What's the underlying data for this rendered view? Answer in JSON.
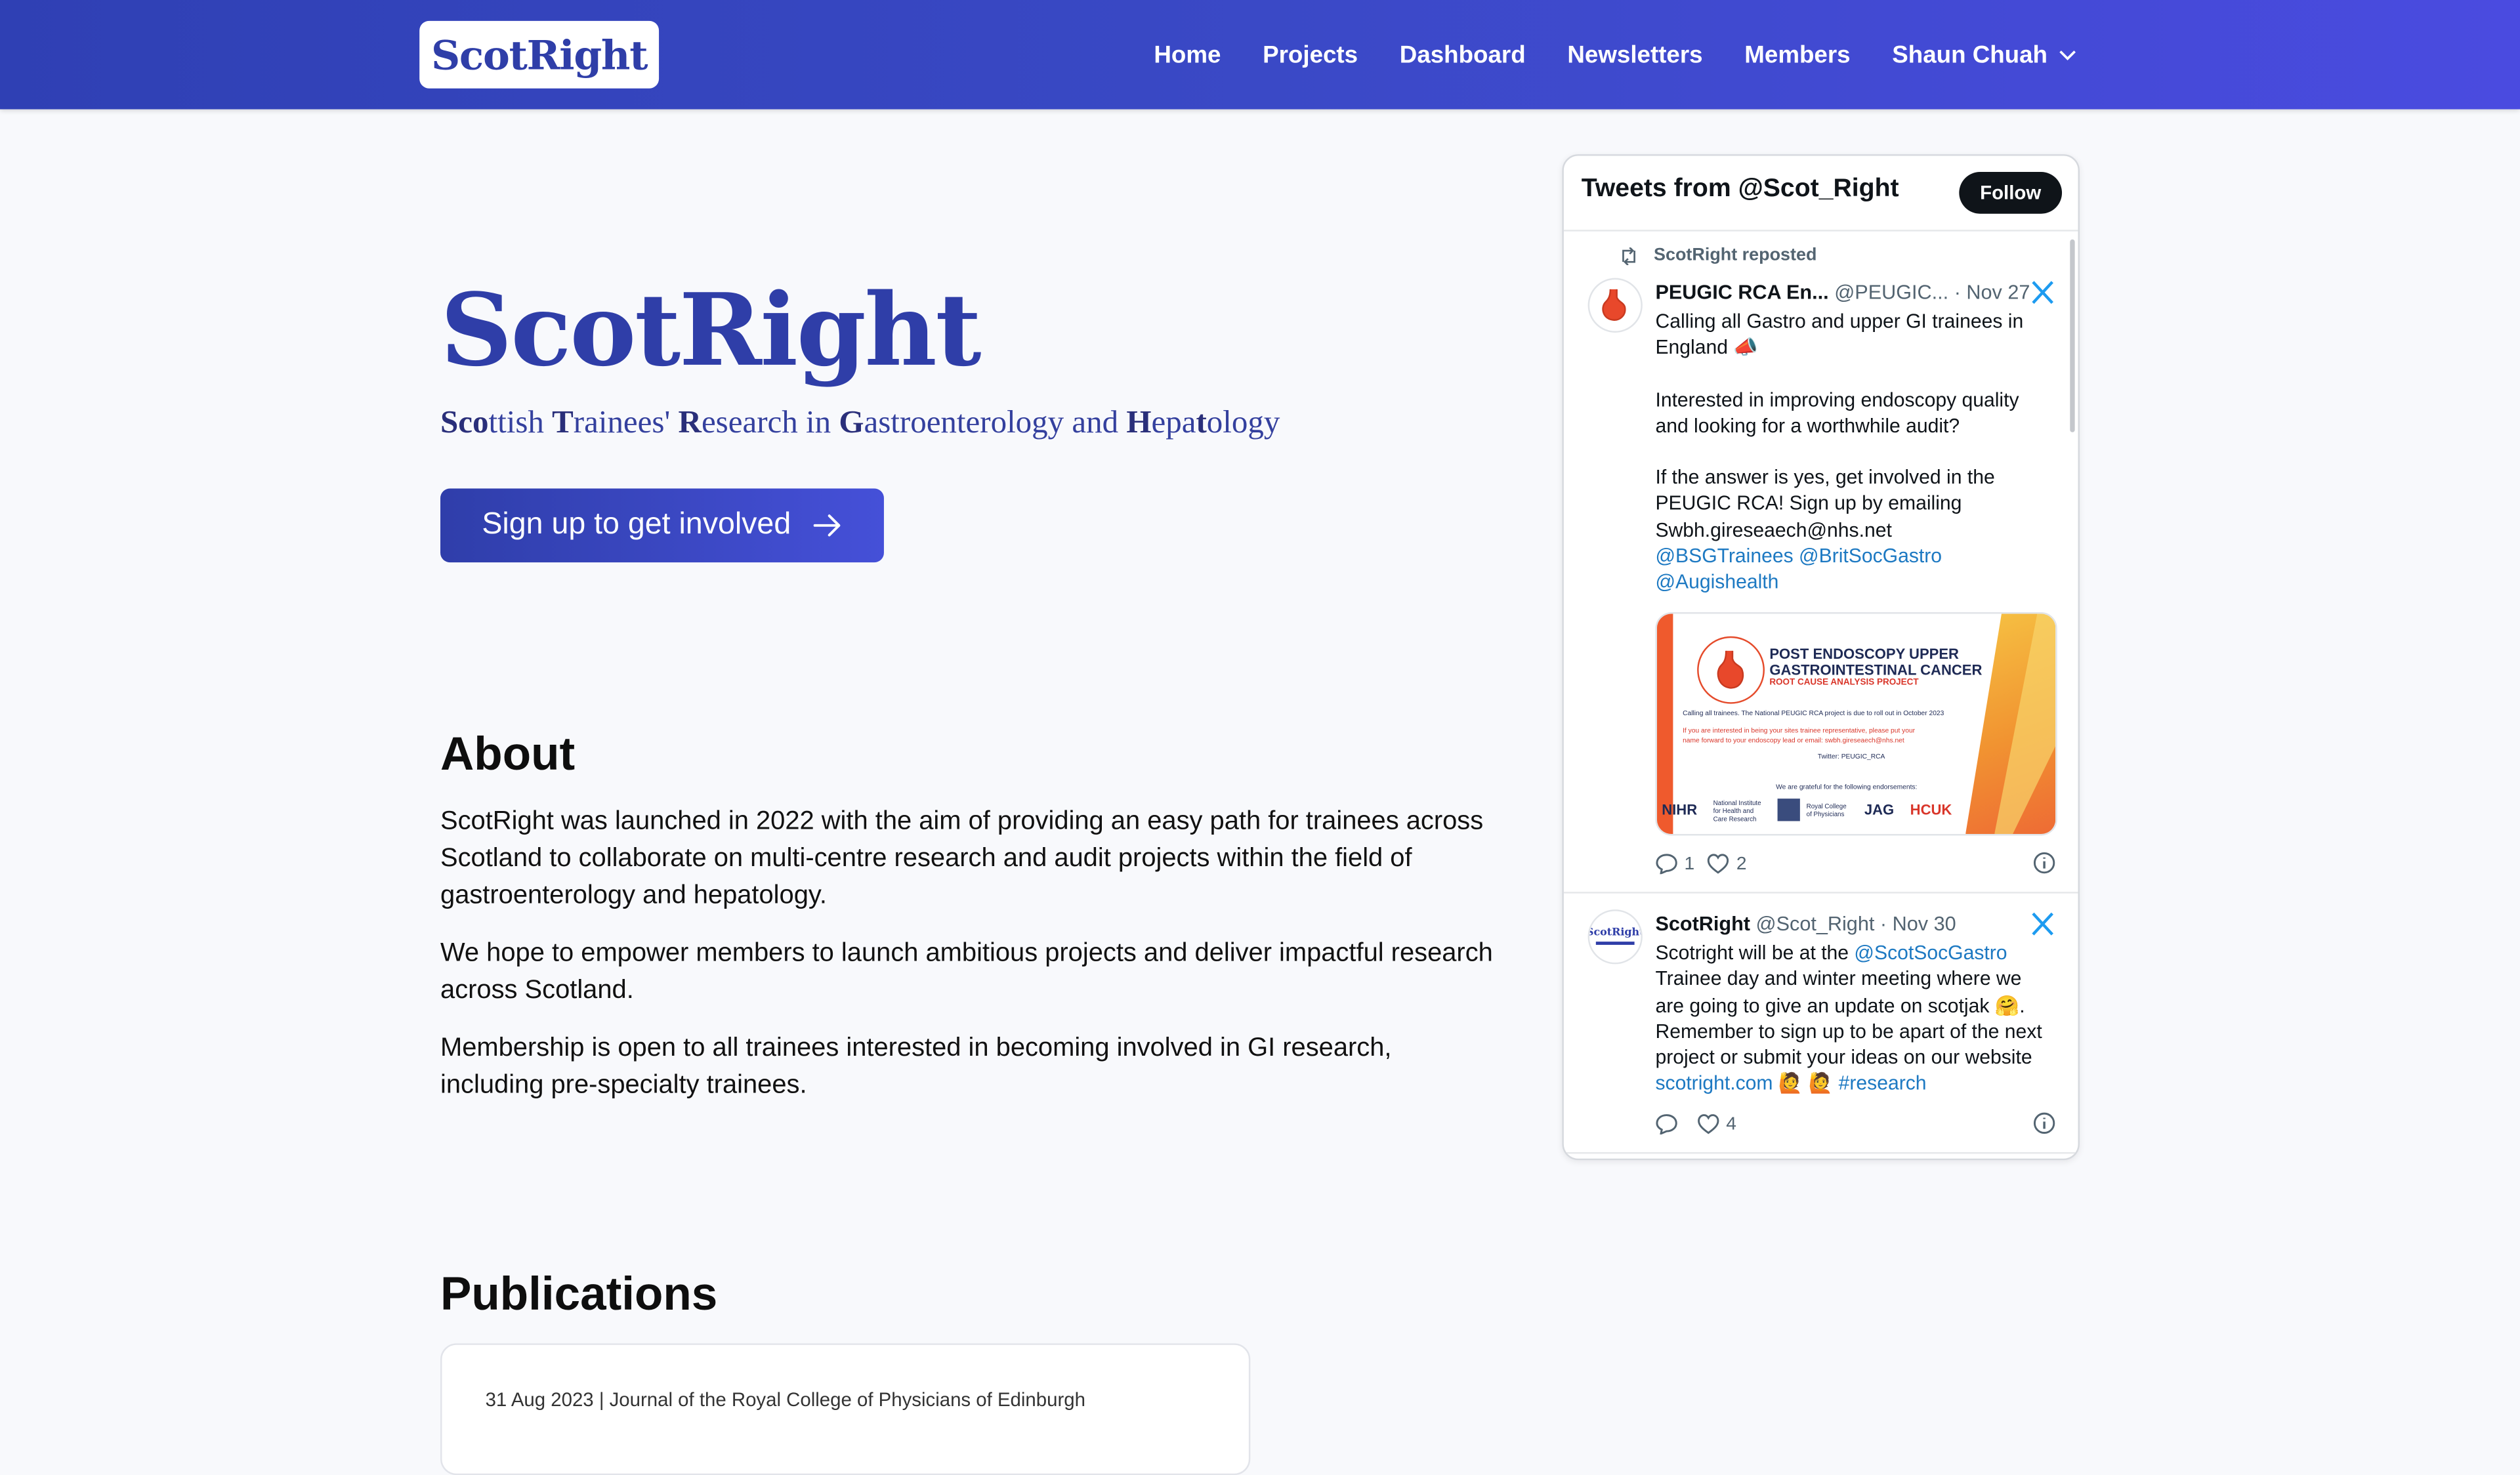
{
  "nav": {
    "logo": "ScotRight",
    "links": [
      "Home",
      "Projects",
      "Dashboard",
      "Newsletters",
      "Members"
    ],
    "user": "Shaun Chuah"
  },
  "hero": {
    "title": "ScotRight",
    "subtitle_parts": [
      {
        "t": "Sco",
        "b": true
      },
      {
        "t": "ttish ",
        "b": false
      },
      {
        "t": "T",
        "b": true
      },
      {
        "t": "rainees' ",
        "b": false
      },
      {
        "t": "R",
        "b": true
      },
      {
        "t": "esearch in ",
        "b": false
      },
      {
        "t": "G",
        "b": true
      },
      {
        "t": "astroenterology and ",
        "b": false
      },
      {
        "t": "H",
        "b": true
      },
      {
        "t": "epa",
        "b": false
      },
      {
        "t": "t",
        "b": true
      },
      {
        "t": "ology",
        "b": false
      }
    ],
    "cta": "Sign up to get involved"
  },
  "about": {
    "heading": "About",
    "p1": "ScotRight was launched in 2022 with the aim of providing an easy path for trainees across Scotland to collaborate on multi-centre research and audit projects within the field of gastroenterology and hepatology.",
    "p2": "We hope to empower members to launch ambitious projects and deliver impactful research across Scotland.",
    "p3": "Membership is open to all trainees interested in becoming involved in GI research, including pre-specialty trainees."
  },
  "publications": {
    "heading": "Publications",
    "items": [
      {
        "meta": "31 Aug 2023 | Journal of the Royal College of Physicians of Edinburgh"
      }
    ]
  },
  "twitter": {
    "title": "Tweets from @Scot_Right",
    "follow": "Follow",
    "tweets": [
      {
        "repost": "ScotRight reposted",
        "name": "PEUGIC RCA En...",
        "handle": "@PEUGIC...",
        "date": "· Nov 27",
        "text1": "Calling all Gastro and upper GI trainees in England 📣",
        "text2": "Interested in improving endoscopy quality and looking for a worthwhile audit?",
        "text3": "If the answer is yes, get involved in the PEUGIC RCA! Sign up by emailing Swbh.gireseaech@nhs.net",
        "mentions": "@BSGTrainees @BritSocGastro @Augishealth",
        "image": {
          "title": "POST ENDOSCOPY UPPER GASTROINTESTINAL CANCER",
          "subtitle": "ROOT CAUSE ANALYSIS PROJECT",
          "line1": "Calling all trainees. The National PEUGIC RCA project is due to roll out in October 2023",
          "line2": "If you are interested in being your sites trainee representative, please put your",
          "line3": "name forward to your endoscopy lead or email: swbh.gireseaech@nhs.net",
          "line4": "Twitter: PEUGIC_RCA",
          "line5": "We are grateful for the following endorsements:",
          "logo1": "NIHR",
          "logo1_sub": "National Institute for Health and Care Research",
          "logo2": "Royal College of Physicians",
          "logo3": "JAG",
          "logo4": "HCUK"
        },
        "replies": "1",
        "likes": "2"
      },
      {
        "name": "ScotRight",
        "handle": "@Scot_Right",
        "date": "· Nov 30",
        "text_a": "Scotright will be at the ",
        "text_mention": "@ScotSocGastro",
        "text_b": " Trainee day and winter meeting where we are going to give an update on scotjak 🤗. Remember to sign up to be apart of the next project or submit your ideas on our website ",
        "text_link": "scotright.com",
        "text_emoji": " 🙋 🙋 ",
        "text_hashtag": "#research",
        "likes": "4"
      }
    ]
  },
  "colors": {
    "brand": "#2f3ea8",
    "nav_start": "#2f40b4",
    "nav_end": "#4a4be0",
    "link": "#1d79c2"
  }
}
